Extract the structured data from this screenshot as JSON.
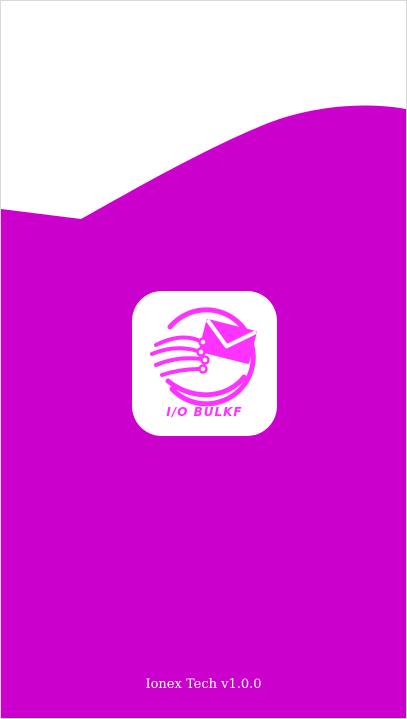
{
  "colors": {
    "primary": "#CC00CC",
    "logo_accent": "#FF33FF",
    "card": "#FFFFFF",
    "text_on_primary": "#FFFFFF",
    "frame_border": "#D8D8D8"
  },
  "logo": {
    "icon": "email-envelope-with-circuit-lines-icon",
    "brand_text": "I/O BULKF"
  },
  "footer": {
    "version_text": "Ionex Tech v1.0.0"
  }
}
